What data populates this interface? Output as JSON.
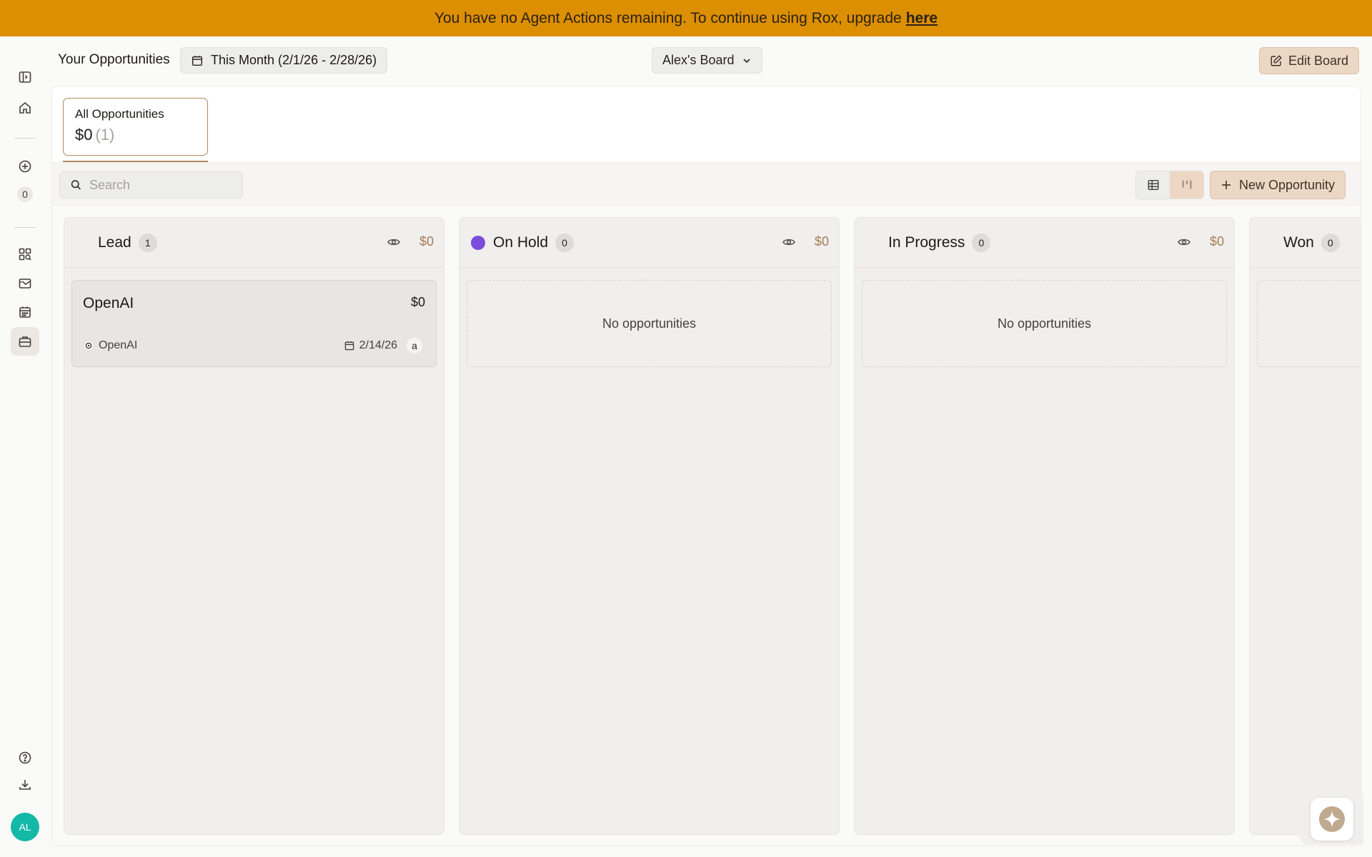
{
  "banner": {
    "message": "You have no Agent Actions remaining. To continue using Rox, upgrade",
    "link": "here",
    "color": "#dc8f00"
  },
  "sidebar": {
    "icons": [
      "sidebar-toggle-icon",
      "home-icon",
      "add-circle-icon",
      "dashboard-search-icon",
      "inbox-icon",
      "calendar-icon",
      "briefcase-icon",
      "help-icon",
      "download-icon"
    ],
    "counter": "0",
    "avatar_initials": "AL",
    "avatar_color": "#14b8a6"
  },
  "header": {
    "title": "Your Opportunities",
    "date_range": "This Month (2/1/26 - 2/28/26)",
    "board": "Alex's Board",
    "edit_label": "Edit Board"
  },
  "summary": {
    "label": "All Opportunities",
    "value": "$0",
    "count": "(1)",
    "accent": "#b58a5e"
  },
  "toolbar": {
    "search_placeholder": "Search",
    "views": [
      "table-view",
      "board-view"
    ],
    "active_view": "board-view",
    "new_label": "New Opportunity"
  },
  "columns": [
    {
      "title": "Lead",
      "count": "1",
      "amount": "$0",
      "dot": "",
      "empty_text": ""
    },
    {
      "title": "On Hold",
      "count": "0",
      "amount": "$0",
      "dot": "#7c4ddb",
      "empty_text": "No opportunities"
    },
    {
      "title": "In Progress",
      "count": "0",
      "amount": "$0",
      "dot": "",
      "empty_text": "No opportunities"
    },
    {
      "title": "Won",
      "count": "0",
      "amount": "",
      "dot": "",
      "empty_text": ""
    }
  ],
  "opportunity": {
    "name": "OpenAI",
    "amount": "$0",
    "company": "OpenAI",
    "date": "2/14/26",
    "owner": "a"
  }
}
